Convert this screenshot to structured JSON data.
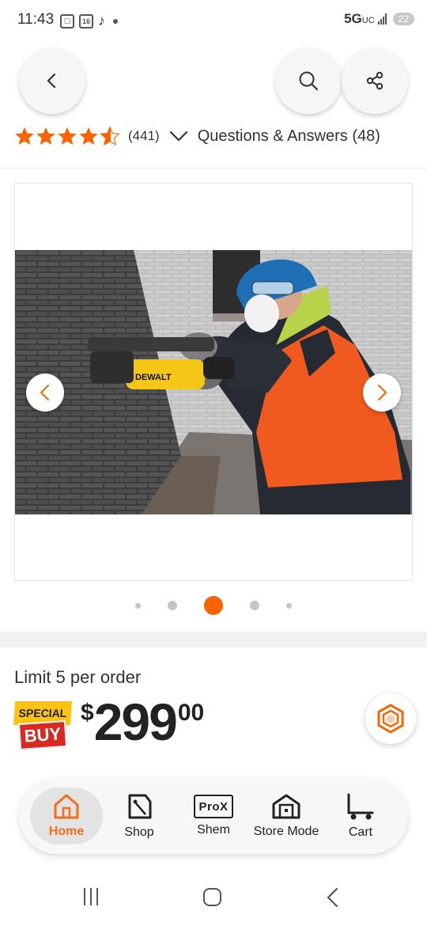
{
  "status_bar": {
    "time": "11:43",
    "network": "5G",
    "network_sub": "UC",
    "battery": "22",
    "icons": [
      "screenshot-icon",
      "calendar-16-icon",
      "tiktok-icon"
    ]
  },
  "header": {
    "back_icon": "chevron-left-icon",
    "search_icon": "search-icon",
    "share_icon": "share-icon"
  },
  "rating": {
    "stars": 4.5,
    "count": "(441)",
    "qa_label": "Questions & Answers (48)",
    "star_color": "#f96302"
  },
  "gallery": {
    "image_alt": "DEWALT grinder in use on brick wall",
    "brand_on_tool": "DEWALT",
    "dots_count": 5,
    "active_dot": 2,
    "accent_color": "#f96302"
  },
  "pricing": {
    "limit_text": "Limit 5 per order",
    "badge_top": "SPECIAL",
    "badge_bottom": "BUY",
    "currency": "$",
    "dollars": "299",
    "cents": "00"
  },
  "bottom_nav": {
    "items": [
      {
        "label": "Home",
        "icon": "home-icon",
        "active": true
      },
      {
        "label": "Shop",
        "icon": "shop-tag-icon",
        "active": false
      },
      {
        "label": "Shem",
        "icon": "prox-icon",
        "active": false
      },
      {
        "label": "Store Mode",
        "icon": "store-icon",
        "active": false
      },
      {
        "label": "Cart",
        "icon": "cart-icon",
        "active": false
      }
    ],
    "prox_text": "ProX"
  }
}
